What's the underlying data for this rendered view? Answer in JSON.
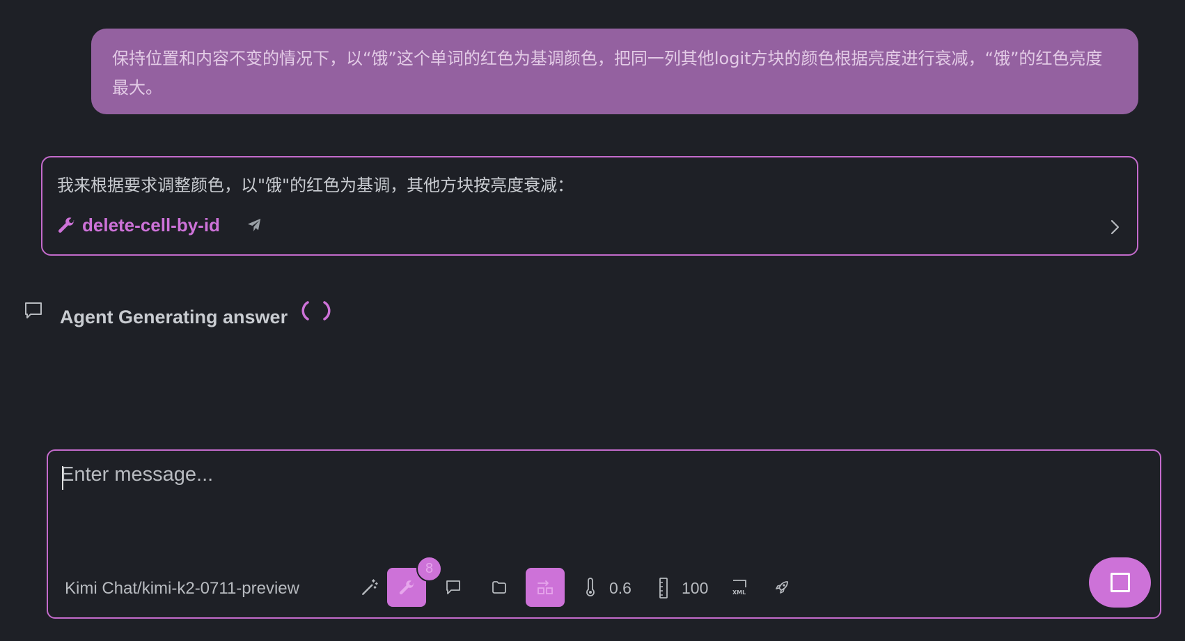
{
  "user_message": {
    "text": "保持位置和内容不变的情况下，以“饿”这个单词的红色为基调颜色，把同一列其他logit方块的颜色根据亮度进行衰减，“饿”的红色亮度最大。"
  },
  "assistant": {
    "text": "我来根据要求调整颜色，以\"饿\"的红色为基调，其他方块按亮度衰减：",
    "tool_call": {
      "name": "delete-cell-by-id",
      "icon": "wrench-icon"
    }
  },
  "status": {
    "text": "Agent Generating answer"
  },
  "composer": {
    "placeholder": "Enter message...",
    "model": "Kimi Chat/kimi-k2-0711-preview",
    "tools_badge": "8",
    "temperature": "0.6",
    "max_tokens": "100"
  },
  "colors": {
    "accent": "#cd72d8",
    "user_bubble": "#9461a0",
    "background": "#1e2026"
  }
}
